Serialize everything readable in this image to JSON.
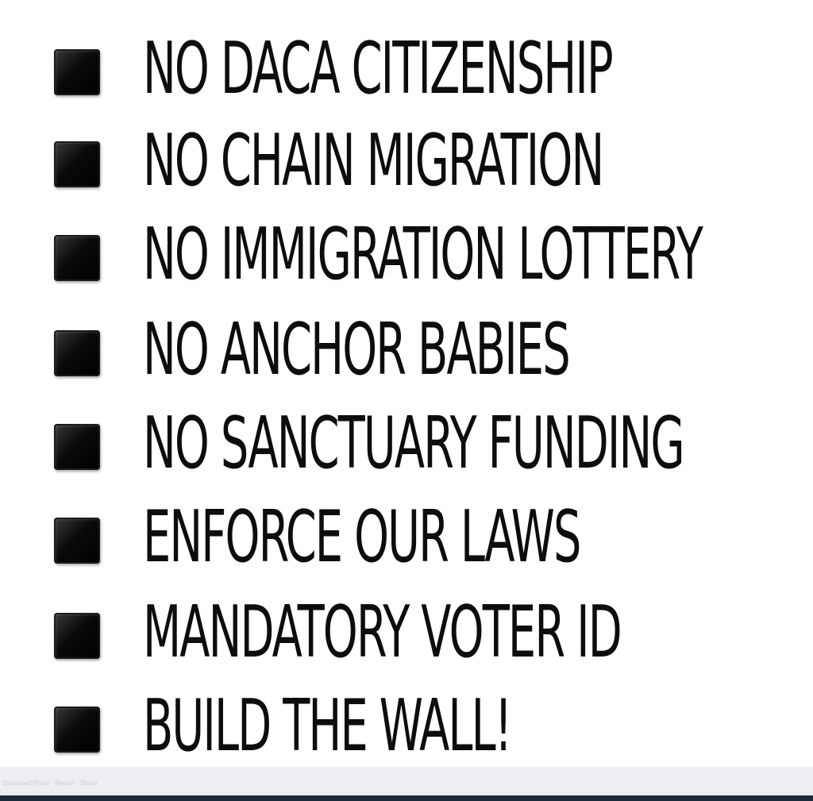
{
  "list": {
    "items": [
      {
        "label": "NO DACA CITIZENSHIP"
      },
      {
        "label": "NO CHAIN MIGRATION"
      },
      {
        "label": "NO IMMIGRATION LOTTERY"
      },
      {
        "label": "NO ANCHOR BABIES"
      },
      {
        "label": "NO SANCTUARY FUNDING"
      },
      {
        "label": "ENFORCE OUR LAWS"
      },
      {
        "label": "MANDATORY VOTER ID"
      },
      {
        "label": "BUILD THE WALL!"
      }
    ]
  },
  "footer": {
    "caption": "Download Photo · Report · Share"
  },
  "colors": {
    "text": "#0d0d0d",
    "bullet": "#000000",
    "background": "#ffffff",
    "footer_bar": "#eceef1",
    "bottom_strip": "#1b2a3a"
  },
  "icons": {
    "bullet": "black-square-icon"
  }
}
